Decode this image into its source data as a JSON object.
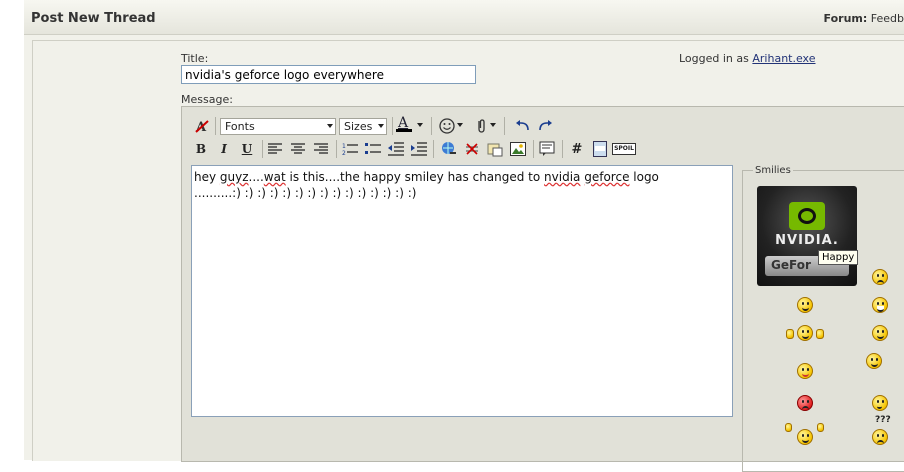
{
  "header": {
    "title": "Post New Thread",
    "forum_label": "Forum:",
    "forum_value": "Feedb"
  },
  "form": {
    "title_label": "Title:",
    "title_value": "nvidia's geforce logo everywhere",
    "message_label": "Message:",
    "logged_in_prefix": "Logged in as",
    "username": "Arihant.exe"
  },
  "toolbar": {
    "font_dropdown": "Fonts",
    "size_dropdown": "Sizes",
    "bold": "B",
    "italic": "I",
    "underline": "U",
    "hash": "#",
    "spoil": "SPOIL"
  },
  "message": {
    "line1_a": "hey ",
    "line1_b": "guyz",
    "line1_c": "....",
    "line1_d": "wat",
    "line1_e": " is this....the happy smiley has changed to ",
    "line1_f": "nvidia",
    "line1_g": " ",
    "line1_h": "geforce",
    "line1_i": " logo",
    "line2": "..........:) :) :) :) :) :) :) :) :) :) :) :) :) :) :)"
  },
  "smilies": {
    "legend": "Smilies",
    "tooltip": "Happy",
    "nvidia_text": "NVIDIA.",
    "geforce_text": "GeFor",
    "question_marks": "???"
  },
  "colors": {
    "nvidia_green": "#76b900",
    "link": "#223377"
  }
}
